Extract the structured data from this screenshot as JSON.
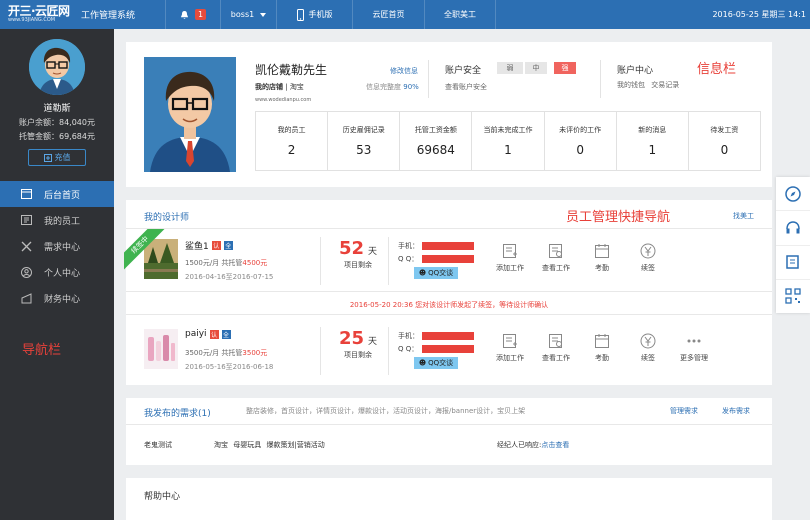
{
  "topbar": {
    "logo_main": "开三·云匠网",
    "logo_sub": "www.93JIANG.COM",
    "system_name": "工作管理系统",
    "notification_count": "1",
    "username": "boss1",
    "mobile_label": "手机版",
    "home_link": "云匠首页",
    "staff_link": "全职美工",
    "datetime": "2016-05-25 星期三 14:1"
  },
  "sidebar": {
    "name": "道勒斯",
    "balance": "账户余额：84,040元",
    "escrow": "托管金额：69,684元",
    "recharge": "充值",
    "menu": [
      {
        "label": "后台首页"
      },
      {
        "label": "我的员工"
      },
      {
        "label": "需求中心"
      },
      {
        "label": "个人中心"
      },
      {
        "label": "财务中心"
      }
    ],
    "annotation": "导航栏"
  },
  "info": {
    "name": "凯伦戴勒先生",
    "edit": "修改信息",
    "shop_label": "我的店铺",
    "shop_value": "淘宝",
    "completeness_label": "信息完整度",
    "completeness_value": "90%",
    "url": "www.wodedianpu.com",
    "security_title": "账户安全",
    "security_levels": [
      "弱",
      "中",
      "强"
    ],
    "security_link": "查看账户安全",
    "account_title": "账户中心",
    "account_links": "我的钱包  交易记录",
    "annotation": "信息栏",
    "stats": [
      {
        "label": "我的员工",
        "value": "2"
      },
      {
        "label": "历史雇佣记录",
        "value": "53"
      },
      {
        "label": "托管工资金额",
        "value": "69684"
      },
      {
        "label": "当前未完成工作",
        "value": "1"
      },
      {
        "label": "未评价的工作",
        "value": "0"
      },
      {
        "label": "新的消息",
        "value": "1"
      },
      {
        "label": "待发工资",
        "value": "0"
      }
    ]
  },
  "designers": {
    "title": "我的设计师",
    "annotation": "员工管理快捷导航",
    "find": "找美工",
    "ribbon": "续签中",
    "rows": [
      {
        "name": "鲨鱼1",
        "price_prefix": "1500元/月 共托管",
        "price_amount": "4500元",
        "dates": "2016-04-16至2016-07-15",
        "days": "52",
        "days_unit": "天",
        "days_caption": "项目剩余",
        "phone_label": "手机：",
        "qq_label": "Q Q：",
        "qq_button": "QQ交谈",
        "actions": [
          "添加工作",
          "查看工作",
          "考勤",
          "续签"
        ]
      },
      {
        "name": "paiyi",
        "price_prefix": "3500元/月 共托管",
        "price_amount": "3500元",
        "dates": "2016-05-16至2016-06-18",
        "days": "25",
        "days_unit": "天",
        "days_caption": "项目剩余",
        "phone_label": "手机：",
        "qq_label": "Q Q：",
        "qq_button": "QQ交谈",
        "actions": [
          "添加工作",
          "查看工作",
          "考勤",
          "续签",
          "更多管理"
        ]
      }
    ],
    "notice": "2016-05-20 20:36 您对该设计师发起了续签，等待设计师确认"
  },
  "requests": {
    "title": "我发布的需求(1)",
    "tags": "整店装修，首页设计，详情页设计，爆款设计，活动页设计，海报/banner设计，宝贝上架",
    "manage": "管理需求",
    "publish": "发布需求",
    "owner": "老鬼测试",
    "categories": "淘宝  母婴玩具  爆款策划|营销活动",
    "status_prefix": "经纪人已响应:",
    "status_link": "点击查看"
  },
  "help": {
    "title": "帮助中心"
  },
  "colors": {
    "brand": "#2c6fb3",
    "sidebar": "#2f3135",
    "accent_red": "#e8413a",
    "ribbon_green": "#3fb34f"
  }
}
